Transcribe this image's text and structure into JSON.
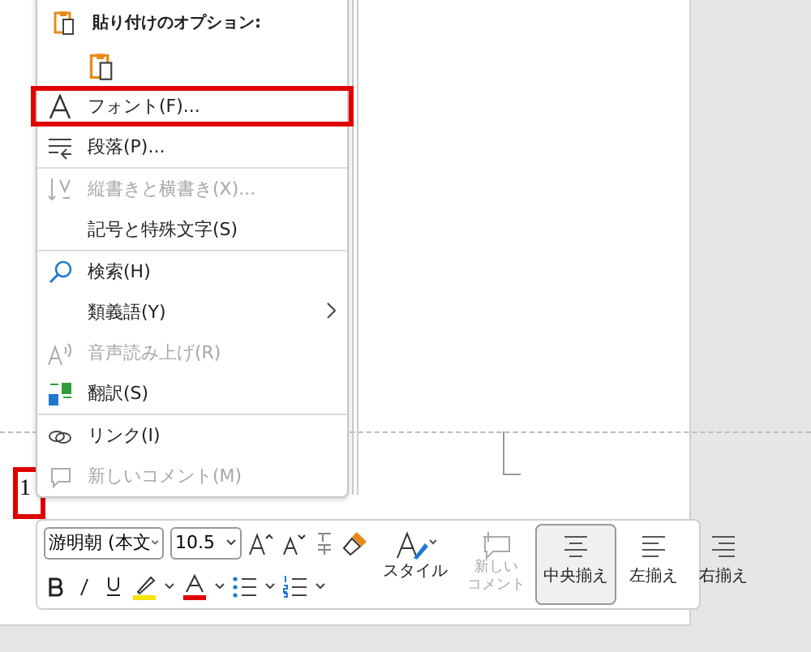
{
  "menu": {
    "paste_header": "貼り付けのオプション:",
    "items": [
      {
        "label": "フォント(F)...",
        "disabled": false,
        "highlighted": true,
        "submenu": false,
        "separator_after": false
      },
      {
        "label": "段落(P)...",
        "disabled": false,
        "highlighted": false,
        "submenu": false,
        "separator_after": true
      },
      {
        "label": "縦書きと横書き(X)...",
        "disabled": true,
        "highlighted": false,
        "submenu": false,
        "separator_after": false
      },
      {
        "label": "記号と特殊文字(S)",
        "disabled": false,
        "highlighted": false,
        "submenu": false,
        "separator_after": true
      },
      {
        "label": "検索(H)",
        "disabled": false,
        "highlighted": false,
        "submenu": false,
        "separator_after": false
      },
      {
        "label": "類義語(Y)",
        "disabled": false,
        "highlighted": false,
        "submenu": true,
        "separator_after": false
      },
      {
        "label": "音声読み上げ(R)",
        "disabled": true,
        "highlighted": false,
        "submenu": false,
        "separator_after": false
      },
      {
        "label": "翻訳(S)",
        "disabled": false,
        "highlighted": false,
        "submenu": false,
        "separator_after": true
      },
      {
        "label": "リンク(I)",
        "disabled": false,
        "highlighted": false,
        "submenu": false,
        "separator_after": false
      },
      {
        "label": "新しいコメント(M)",
        "disabled": true,
        "highlighted": false,
        "submenu": false,
        "separator_after": false
      }
    ]
  },
  "document": {
    "line_number": "1"
  },
  "toolbar": {
    "font": "游明朝 (本文",
    "size": "10.5",
    "style_label": "スタイル",
    "comment": {
      "lines": [
        "新しい",
        "コメント"
      ],
      "disabled": true
    },
    "align": [
      {
        "label": "中央揃え",
        "selected": true
      },
      {
        "label": "左揃え",
        "selected": false
      },
      {
        "label": "右揃え",
        "selected": false
      }
    ]
  }
}
